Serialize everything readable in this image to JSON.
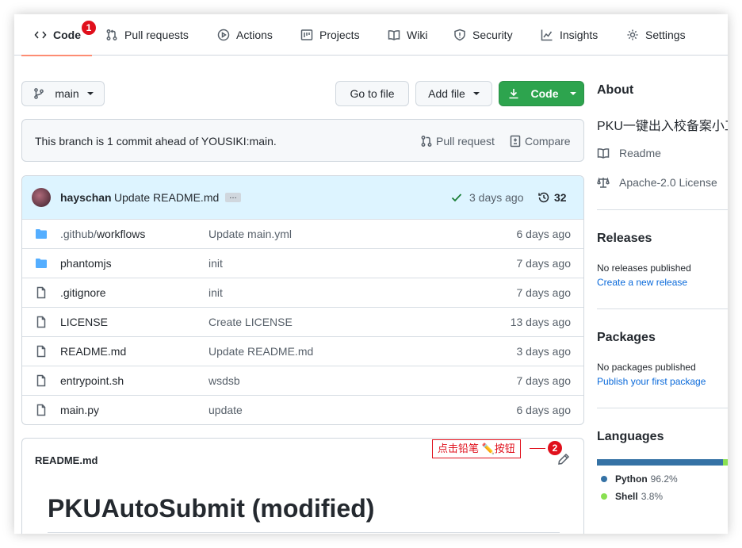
{
  "nav": {
    "tabs": [
      {
        "label": "Code"
      },
      {
        "label": "Pull requests"
      },
      {
        "label": "Actions"
      },
      {
        "label": "Projects"
      },
      {
        "label": "Wiki"
      },
      {
        "label": "Security"
      },
      {
        "label": "Insights"
      },
      {
        "label": "Settings"
      }
    ],
    "step_badge": "1"
  },
  "toolbar": {
    "branch": "main",
    "go_to_file": "Go to file",
    "add_file": "Add file",
    "code": "Code"
  },
  "branch_status": {
    "text": "This branch is 1 commit ahead of YOUSIKI:main.",
    "pull_request": "Pull request",
    "compare": "Compare"
  },
  "commit": {
    "author": "hayschan",
    "message": "Update README.md",
    "ellipsis": "…",
    "time": "3 days ago",
    "count": "32"
  },
  "files": [
    {
      "type": "folder",
      "prefix": ".github/",
      "name": "workflows",
      "message": "Update main.yml",
      "age": "6 days ago"
    },
    {
      "type": "folder",
      "prefix": "",
      "name": "phantomjs",
      "message": "init",
      "age": "7 days ago"
    },
    {
      "type": "file",
      "prefix": "",
      "name": ".gitignore",
      "message": "init",
      "age": "7 days ago"
    },
    {
      "type": "file",
      "prefix": "",
      "name": "LICENSE",
      "message": "Create LICENSE",
      "age": "13 days ago"
    },
    {
      "type": "file",
      "prefix": "",
      "name": "README.md",
      "message": "Update README.md",
      "age": "3 days ago"
    },
    {
      "type": "file",
      "prefix": "",
      "name": "entrypoint.sh",
      "message": "wsdsb",
      "age": "7 days ago"
    },
    {
      "type": "file",
      "prefix": "",
      "name": "main.py",
      "message": "update",
      "age": "6 days ago"
    }
  ],
  "readme": {
    "filename": "README.md",
    "heading": "PKUAutoSubmit (modified)",
    "annotation": "点击铅笔 ✏️按钮",
    "step_badge": "2"
  },
  "sidebar": {
    "about_title": "About",
    "description": "PKU一键出入校备案小工具",
    "readme": "Readme",
    "license": "Apache-2.0 License",
    "releases_title": "Releases",
    "releases_text": "No releases published",
    "releases_link": "Create a new release",
    "packages_title": "Packages",
    "packages_text": "No packages published",
    "packages_link": "Publish your first package",
    "languages_title": "Languages",
    "languages": [
      {
        "name": "Python",
        "percent": "96.2%",
        "value": 96.2,
        "color": "#3572A5"
      },
      {
        "name": "Shell",
        "percent": "3.8%",
        "value": 3.8,
        "color": "#89e051"
      }
    ]
  },
  "colors": {
    "accent_orange": "#fd8c73",
    "green_button": "#2da44e",
    "link": "#0969da",
    "annotation_red": "#e0101c"
  }
}
